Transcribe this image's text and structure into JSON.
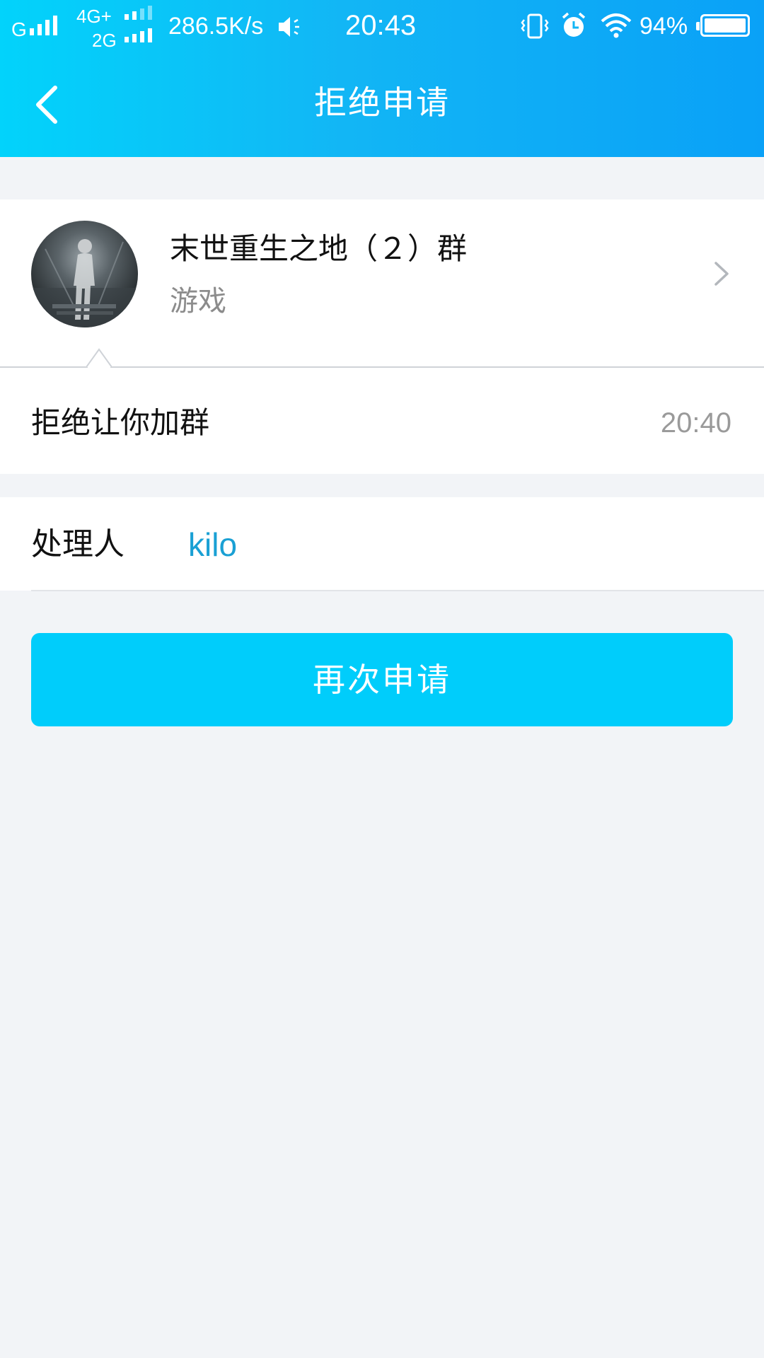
{
  "status_bar": {
    "carrier1": "G",
    "network_top": "4G+",
    "network_bottom": "2G",
    "speed": "286.5K/s",
    "time": "20:43",
    "battery": "94%",
    "icons": [
      "signal-icon",
      "signal-icon",
      "speaker-icon",
      "vibrate-icon",
      "alarm-icon",
      "wifi-icon",
      "battery-icon"
    ]
  },
  "header": {
    "title": "拒绝申请",
    "back_icon": "back-chevron-icon"
  },
  "group": {
    "name": "末世重生之地（２）群",
    "category": "游戏",
    "chevron_icon": "chevron-right-icon"
  },
  "message": {
    "text": "拒绝让你加群",
    "time": "20:40"
  },
  "handler": {
    "label": "处理人",
    "value": "kilo"
  },
  "actions": {
    "reapply_label": "再次申请"
  },
  "colors": {
    "header_start": "#02d3fb",
    "header_end": "#0aa1f7",
    "button": "#00cdfb",
    "link": "#1aa0d4",
    "background": "#f2f4f7"
  }
}
